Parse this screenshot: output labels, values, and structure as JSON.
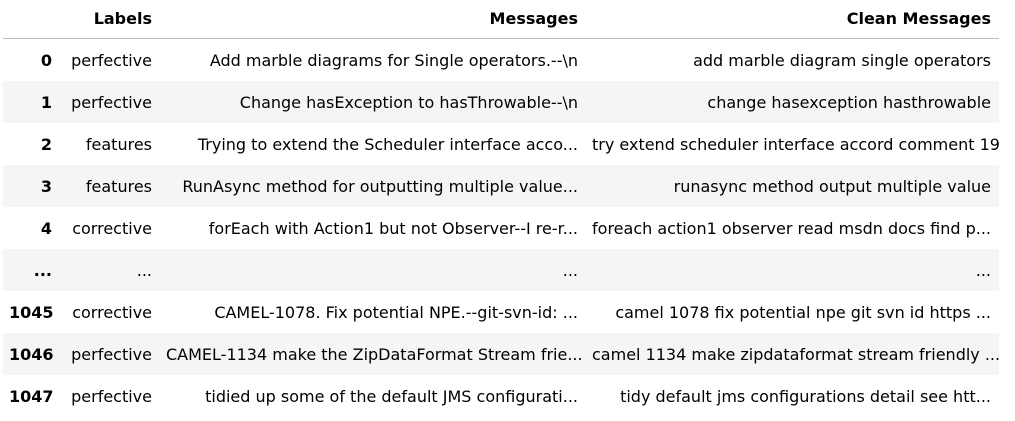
{
  "table": {
    "columns": [
      "Labels",
      "Messages",
      "Clean Messages"
    ],
    "rows": [
      {
        "index": "0",
        "label": "perfective",
        "message": "Add marble diagrams for Single operators.--\\n",
        "clean": "add marble diagram single operators"
      },
      {
        "index": "1",
        "label": "perfective",
        "message": "Change hasException to hasThrowable--\\n",
        "clean": "change hasexception hasthrowable"
      },
      {
        "index": "2",
        "label": "features",
        "message": "Trying to extend the Scheduler interface acco...",
        "clean": "try extend scheduler interface accord comment 19"
      },
      {
        "index": "3",
        "label": "features",
        "message": "RunAsync method for outputting multiple value...",
        "clean": "runasync method output multiple value"
      },
      {
        "index": "4",
        "label": "corrective",
        "message": "forEach with Action1 but not Observer--I re-r...",
        "clean": "foreach action1 observer read msdn docs find p..."
      },
      {
        "index": "...",
        "label": "...",
        "message": "...",
        "clean": "..."
      },
      {
        "index": "1045",
        "label": "corrective",
        "message": "CAMEL-1078. Fix potential NPE.--git-svn-id: ...",
        "clean": "camel 1078 fix potential npe git svn id https ..."
      },
      {
        "index": "1046",
        "label": "perfective",
        "message": "CAMEL-1134 make the ZipDataFormat Stream frie...",
        "clean": "camel 1134 make zipdataformat stream friendly ..."
      },
      {
        "index": "1047",
        "label": "perfective",
        "message": "tidied up some of the default JMS configurati...",
        "clean": "tidy default jms configurations detail see htt..."
      }
    ]
  },
  "colors": {
    "stripe": "#f5f5f5",
    "header_rule": "#bdbdbd",
    "text": "#000000"
  }
}
